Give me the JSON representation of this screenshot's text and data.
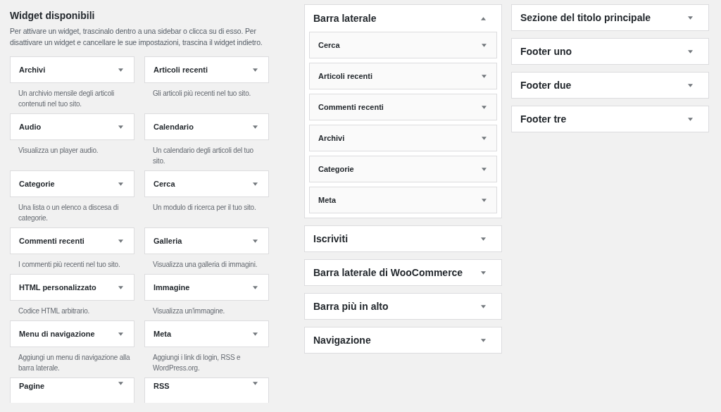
{
  "available": {
    "title": "Widget disponibili",
    "description": "Per attivare un widget, trascinalo dentro a una sidebar o clicca su di esso. Per disattivare un widget e cancellare le sue impostazioni, trascina il widget indietro.",
    "widgets": [
      {
        "name": "Archivi",
        "description": "Un archivio mensile degli articoli contenuti nel tuo sito."
      },
      {
        "name": "Articoli recenti",
        "description": "Gli articoli più recenti nel tuo sito."
      },
      {
        "name": "Audio",
        "description": "Visualizza un player audio."
      },
      {
        "name": "Calendario",
        "description": "Un calendario degli articoli del tuo sito."
      },
      {
        "name": "Categorie",
        "description": "Una lista o un elenco a discesa di categorie."
      },
      {
        "name": "Cerca",
        "description": "Un modulo di ricerca per il tuo sito."
      },
      {
        "name": "Commenti recenti",
        "description": "I commenti più recenti nel tuo sito."
      },
      {
        "name": "Galleria",
        "description": "Visualizza una galleria di immagini."
      },
      {
        "name": "HTML personalizzato",
        "description": "Codice HTML arbitrario."
      },
      {
        "name": "Immagine",
        "description": "Visualizza un'immagine."
      },
      {
        "name": "Menu di navigazione",
        "description": "Aggiungi un menu di navigazione alla barra laterale."
      },
      {
        "name": "Meta",
        "description": "Aggiungi i link di login, RSS e WordPress.org."
      },
      {
        "name": "Pagine"
      },
      {
        "name": "RSS"
      }
    ]
  },
  "sidebar_columns": [
    {
      "sidebars": [
        {
          "title": "Barra laterale",
          "expanded": true,
          "widgets": [
            {
              "name": "Cerca"
            },
            {
              "name": "Articoli recenti"
            },
            {
              "name": "Commenti recenti"
            },
            {
              "name": "Archivi"
            },
            {
              "name": "Categorie"
            },
            {
              "name": "Meta"
            }
          ]
        },
        {
          "title": "Iscriviti",
          "expanded": false
        },
        {
          "title": "Barra laterale di WooCommerce",
          "expanded": false
        },
        {
          "title": "Barra più in alto",
          "expanded": false
        },
        {
          "title": "Navigazione",
          "expanded": false
        }
      ]
    },
    {
      "sidebars": [
        {
          "title": "Sezione del titolo principale",
          "expanded": false
        },
        {
          "title": "Footer uno",
          "expanded": false
        },
        {
          "title": "Footer due",
          "expanded": false
        },
        {
          "title": "Footer tre",
          "expanded": false
        }
      ]
    }
  ]
}
